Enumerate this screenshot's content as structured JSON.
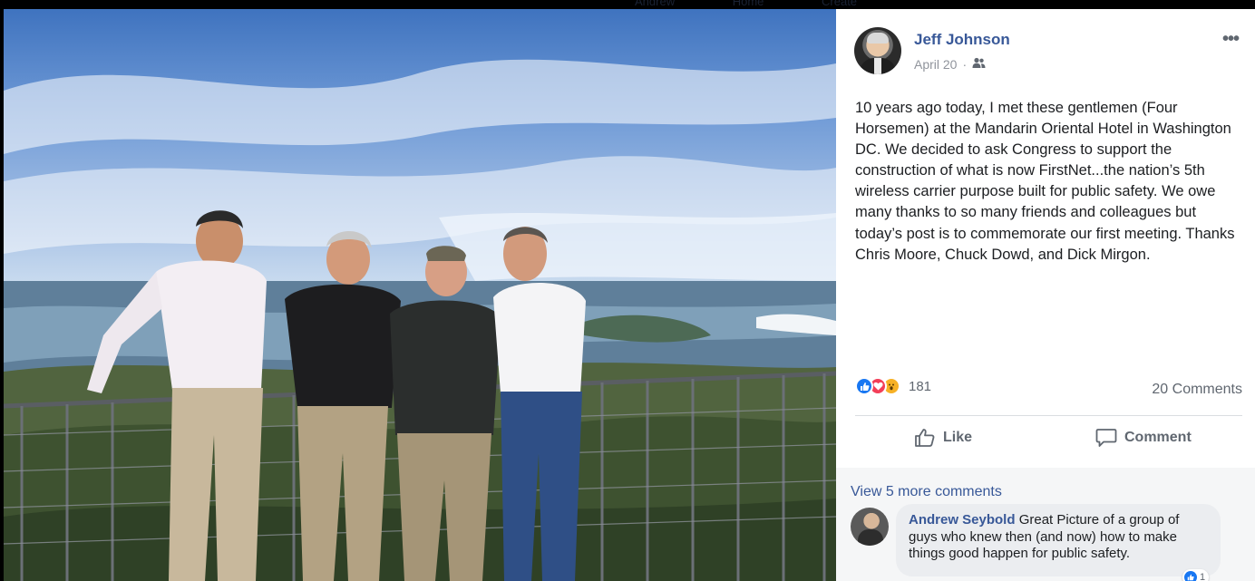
{
  "background_nav": {
    "items": [
      "Andrew",
      "Home",
      "Create"
    ]
  },
  "post": {
    "author": "Jeff Johnson",
    "date": "April 20",
    "audience_icon": "friends-icon",
    "more_icon": "more-options-icon",
    "more_label": "•••",
    "text": "10 years ago today, I met these gentlemen (Four Horsemen) at the Mandarin Oriental Hotel in Washington DC. We decided to ask Congress to support the construction of what is now FirstNet...the nation’s 5th wireless carrier purpose built for public safety. We owe many thanks to so many friends and colleagues but today’s post is to commemorate our first meeting. Thanks Chris Moore, Chuck Dowd, and Dick Mirgon."
  },
  "reactions": {
    "icons": [
      "like-reaction-icon",
      "love-reaction-icon",
      "wow-reaction-icon"
    ],
    "count": "181",
    "comments_count": "20 Comments"
  },
  "actions": {
    "like_label": "Like",
    "comment_label": "Comment"
  },
  "comments": {
    "view_more": "View 5 more comments",
    "items": [
      {
        "author": "Andrew Seybold",
        "text": "Great Picture of a group of guys who knew then (and now) how to make things good happen for public safety.",
        "like_count": "1"
      }
    ]
  },
  "colors": {
    "link_blue": "#385898",
    "like_blue": "#1877f2",
    "love_red": "#f33e58",
    "wow_yellow": "#f7b125",
    "muted_text": "#606770"
  }
}
